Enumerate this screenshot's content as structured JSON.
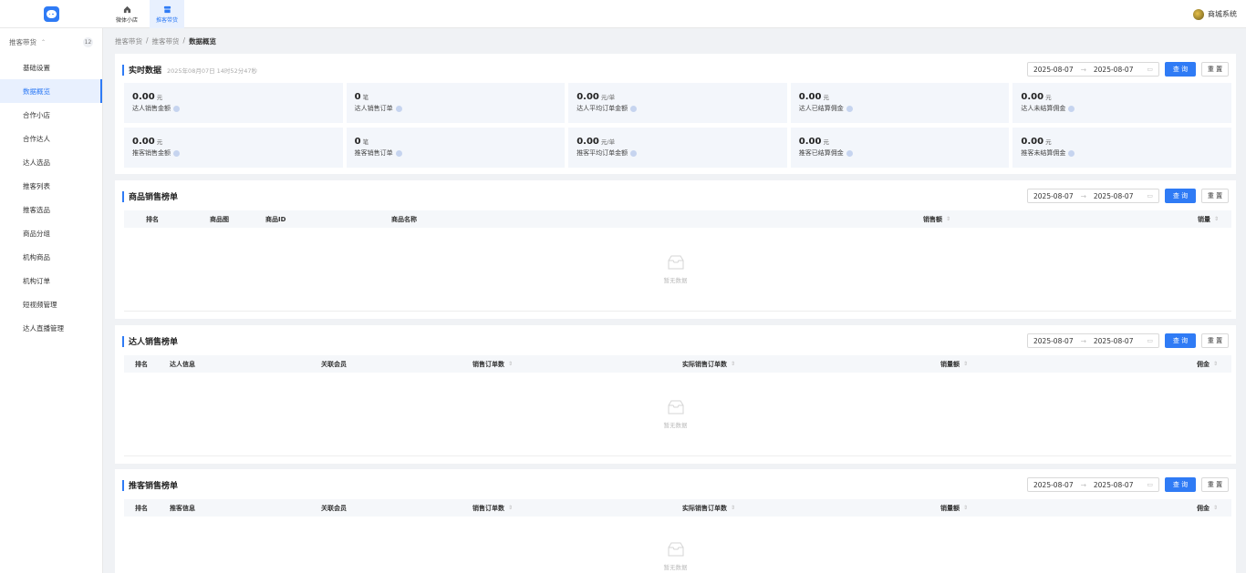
{
  "topbar": {
    "nav": [
      {
        "label": "微体小店",
        "icon": "home-icon"
      },
      {
        "label": "推客带货",
        "icon": "store-icon"
      }
    ],
    "user": "商城系统"
  },
  "sidebar": {
    "group": {
      "label": "推客带货",
      "count": "12"
    },
    "items": [
      {
        "label": "基础设置"
      },
      {
        "label": "数据概览"
      },
      {
        "label": "合作小店"
      },
      {
        "label": "合作达人"
      },
      {
        "label": "达人选品"
      },
      {
        "label": "推客列表"
      },
      {
        "label": "推客选品"
      },
      {
        "label": "商品分组"
      },
      {
        "label": "机构商品"
      },
      {
        "label": "机构订单"
      },
      {
        "label": "短视频管理"
      },
      {
        "label": "达人直播管理"
      }
    ]
  },
  "breadcrumb": [
    "推客带货",
    "/",
    "推客带货",
    "/",
    "数据概览"
  ],
  "filters": {
    "start": "2025-08-07",
    "arrow": "→",
    "end": "2025-08-07",
    "query": "查 询",
    "reset": "重 置"
  },
  "realtime": {
    "title": "实时数据",
    "time": "2025年08月07日 14时52分47秒",
    "stats": [
      {
        "value": "0.00",
        "unit": "元",
        "label": "达人销售金额"
      },
      {
        "value": "0",
        "unit": "笔",
        "label": "达人销售订单"
      },
      {
        "value": "0.00",
        "unit": "元/单",
        "label": "达人平均订单金额"
      },
      {
        "value": "0.00",
        "unit": "元",
        "label": "达人已结算佣金"
      },
      {
        "value": "0.00",
        "unit": "元",
        "label": "达人未结算佣金"
      },
      {
        "value": "0.00",
        "unit": "元",
        "label": "推客销售金额"
      },
      {
        "value": "0",
        "unit": "笔",
        "label": "推客销售订单"
      },
      {
        "value": "0.00",
        "unit": "元/单",
        "label": "推客平均订单金额"
      },
      {
        "value": "0.00",
        "unit": "元",
        "label": "推客已结算佣金"
      },
      {
        "value": "0.00",
        "unit": "元",
        "label": "推客未结算佣金"
      }
    ]
  },
  "product_rank": {
    "title": "商品销售榜单",
    "columns": [
      "排名",
      "商品图",
      "商品ID",
      "商品名称",
      "销售额",
      "销量"
    ],
    "empty": "暂无数据"
  },
  "talent_rank": {
    "title": "达人销售榜单",
    "columns": [
      "排名",
      "达人信息",
      "关联会员",
      "销售订单数",
      "实际销售订单数",
      "销量额",
      "佣金"
    ],
    "empty": "暂无数据"
  },
  "promoter_rank": {
    "title": "推客销售榜单",
    "columns": [
      "排名",
      "推客信息",
      "关联会员",
      "销售订单数",
      "实际销售订单数",
      "销量额",
      "佣金"
    ],
    "empty": "暂无数据"
  }
}
